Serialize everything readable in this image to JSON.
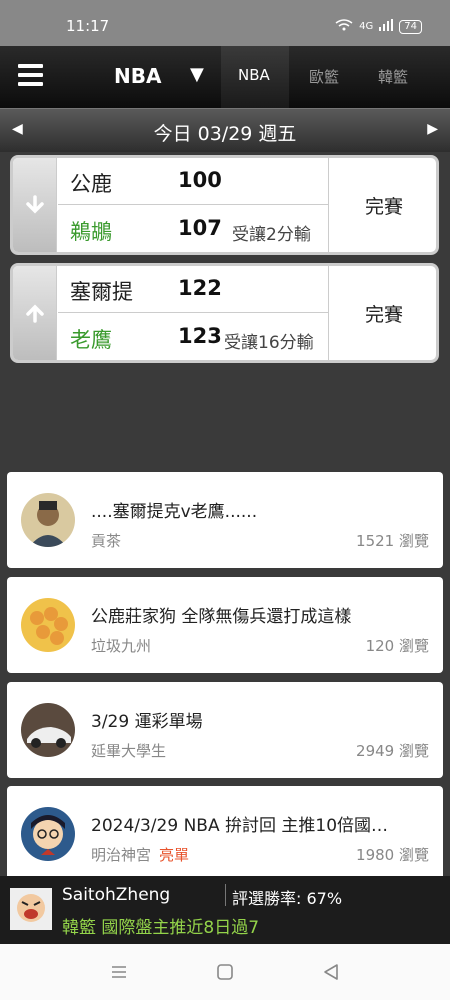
{
  "status_bar": {
    "time": "11:17",
    "signal_text": "4G",
    "battery": "74"
  },
  "top_nav": {
    "title": "NBA",
    "tabs": [
      {
        "label": "NBA",
        "active": true
      },
      {
        "label": "歐籃",
        "active": false
      },
      {
        "label": "韓籃",
        "active": false
      }
    ]
  },
  "date_bar": {
    "label": "今日 03/29 週五"
  },
  "games": [
    {
      "trend_icon": "arrow-down-icon",
      "home": {
        "team": "公鹿",
        "score": "100"
      },
      "away": {
        "team": "鵜鶘",
        "score": "107",
        "handicap": "受讓2分輸"
      },
      "status": "完賽"
    },
    {
      "trend_icon": "arrow-up-icon",
      "home": {
        "team": "塞爾提",
        "score": "122"
      },
      "away": {
        "team": "老鷹",
        "score": "123",
        "handicap": "受讓16分輸"
      },
      "status": "完賽"
    }
  ],
  "posts": [
    {
      "title": "....塞爾提克v老鷹......",
      "author": "貢茶",
      "badge": "",
      "views": "1521 瀏覽"
    },
    {
      "title": "公鹿莊家狗 全隊無傷兵還打成這樣",
      "author": "垃圾九州",
      "badge": "",
      "views": "120 瀏覽"
    },
    {
      "title": "3/29 運彩單場",
      "author": "延畢大學生",
      "badge": "",
      "views": "2949 瀏覽"
    },
    {
      "title": "2024/3/29 NBA 拚討回 主推10倍國…",
      "author": "明治神宮",
      "badge": "亮單",
      "views": "1980 瀏覽"
    }
  ],
  "bottom_user": {
    "name": "SaitohZheng",
    "win_rate": "評選勝率: 67%",
    "pick": "韓籃 國際盤主推近8日過7"
  },
  "colors": {
    "accent_green": "#3a9a2d",
    "pick_green": "#93d34a",
    "badge_red": "#e8542d"
  }
}
